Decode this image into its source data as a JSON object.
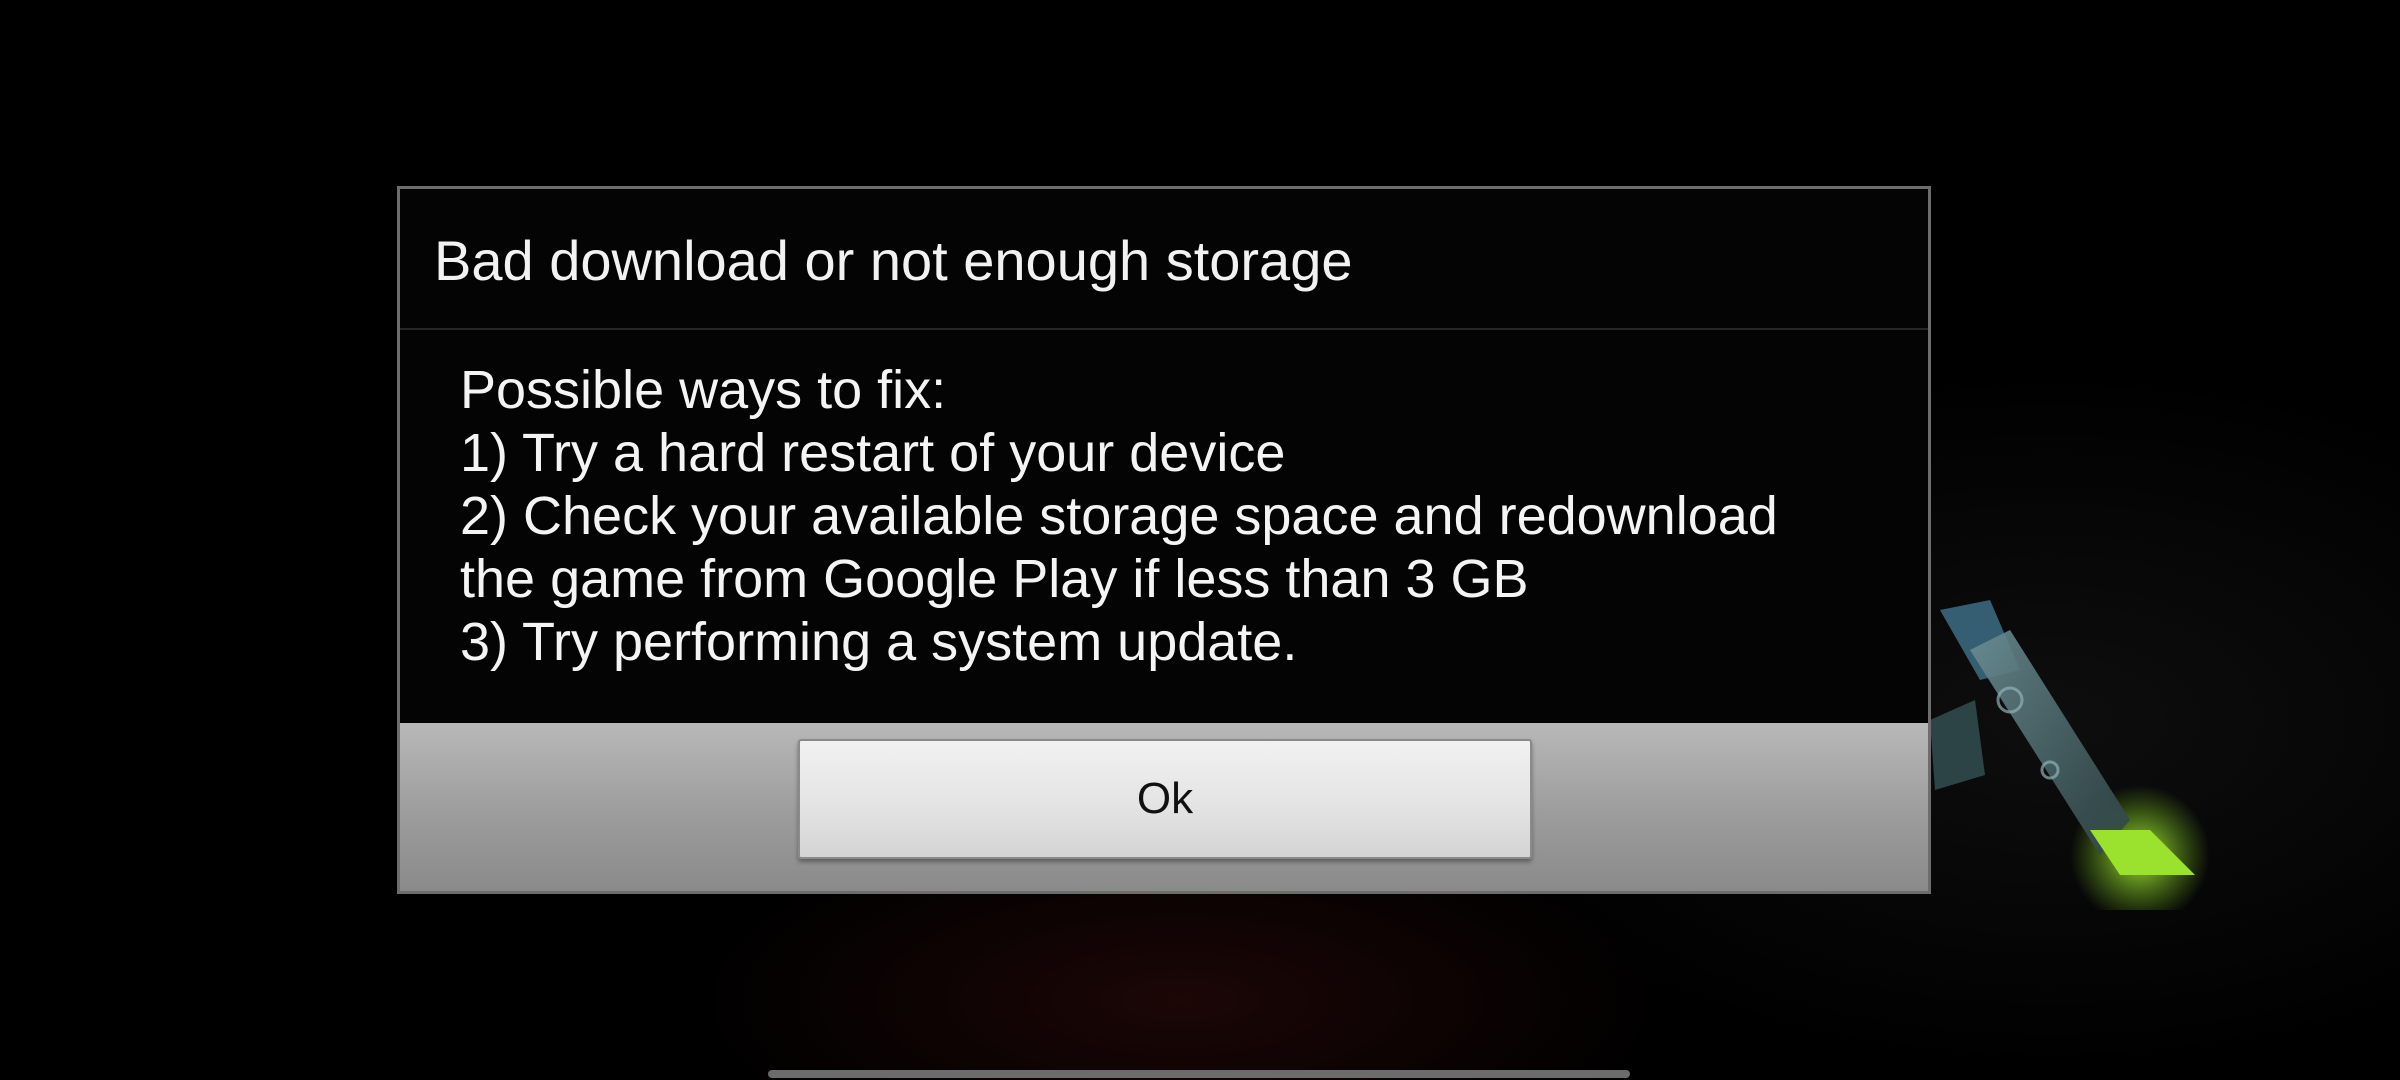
{
  "dialog": {
    "title": "Bad download or not enough storage",
    "body_lines": [
      "Possible ways to fix:",
      "1) Try a hard restart of your device",
      "2) Check your available storage space and redownload",
      "the game from Google Play if less than 3 GB",
      "3) Try performing a system update."
    ],
    "ok_label": "Ok"
  },
  "background": {
    "logo_icon": "ark-logo-icon",
    "logo_accent_color": "#8fd82a",
    "logo_stone_color": "#4a6a6e"
  },
  "system": {
    "home_indicator_icon": "home-indicator-bar"
  }
}
